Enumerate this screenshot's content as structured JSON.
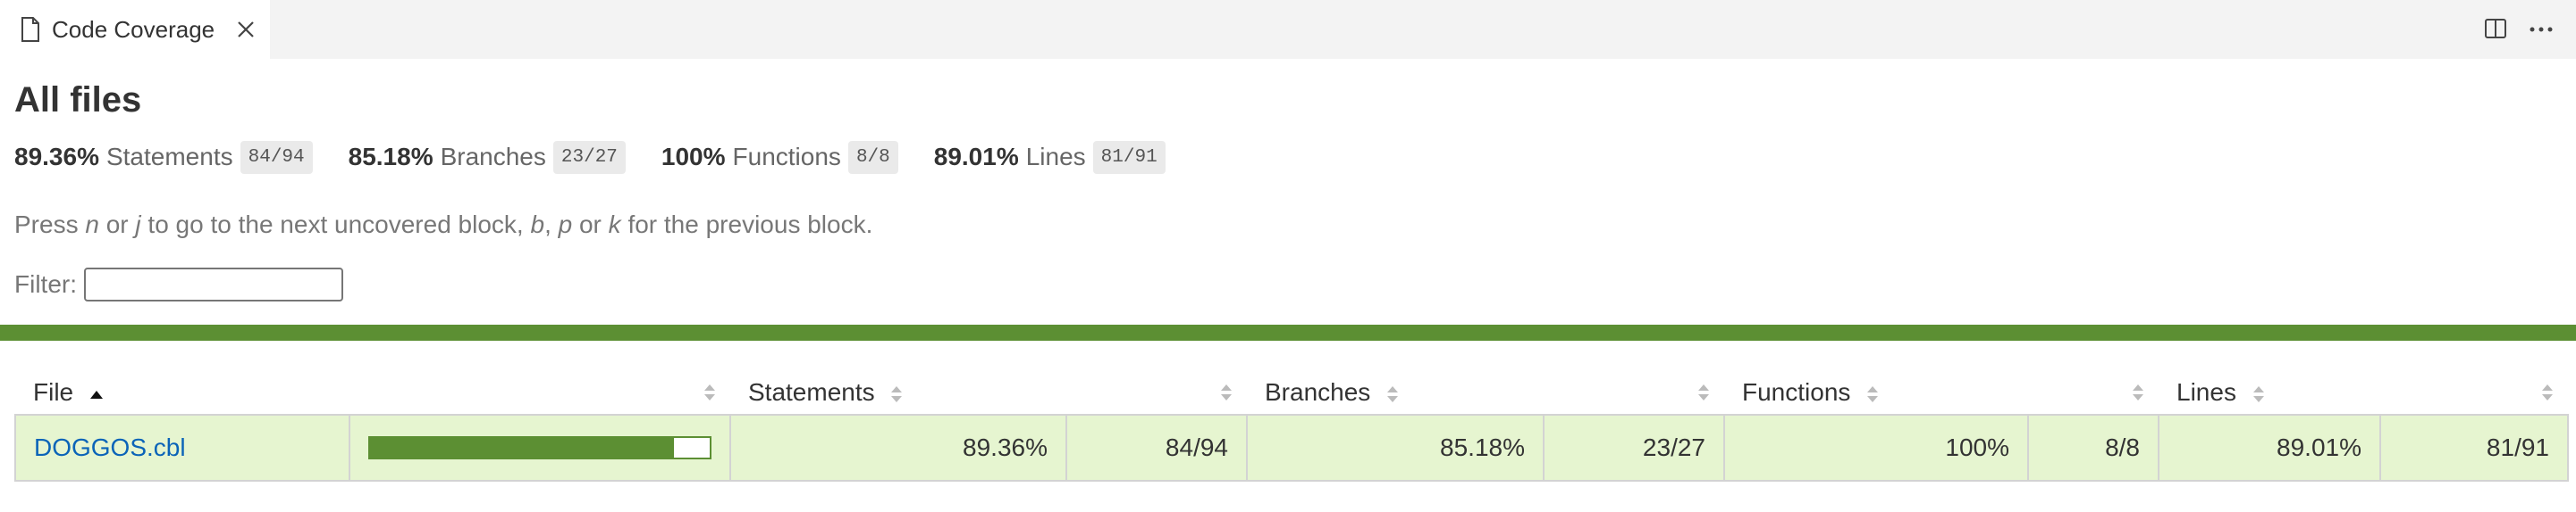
{
  "tab": {
    "title": "Code Coverage"
  },
  "page": {
    "title": "All files"
  },
  "summary": [
    {
      "pct": "89.36%",
      "label": "Statements",
      "fraction": "84/94"
    },
    {
      "pct": "85.18%",
      "label": "Branches",
      "fraction": "23/27"
    },
    {
      "pct": "100%",
      "label": "Functions",
      "fraction": "8/8"
    },
    {
      "pct": "89.01%",
      "label": "Lines",
      "fraction": "81/91"
    }
  ],
  "hint": {
    "part1": "Press ",
    "key_n": "n",
    "part2": " or ",
    "key_j": "j",
    "part3": " to go to the next uncovered block, ",
    "key_b": "b",
    "part4": ", ",
    "key_p": "p",
    "part5": " or ",
    "key_k": "k",
    "part6": " for the previous block."
  },
  "filter": {
    "label": "Filter:",
    "value": "",
    "placeholder": ""
  },
  "table": {
    "headers": {
      "file": "File",
      "statements": "Statements",
      "branches": "Branches",
      "functions": "Functions",
      "lines": "Lines"
    },
    "rows": [
      {
        "file": "DOGGOS.cbl",
        "coverage_fraction": 0.8936,
        "statements_pct": "89.36%",
        "statements_frac": "84/94",
        "branches_pct": "85.18%",
        "branches_frac": "23/27",
        "functions_pct": "100%",
        "functions_frac": "8/8",
        "lines_pct": "89.01%",
        "lines_frac": "81/91"
      }
    ]
  },
  "colors": {
    "coverage_high": "#5c8f33",
    "row_high_bg": "#e6f5d0",
    "link": "#0b64b8"
  }
}
